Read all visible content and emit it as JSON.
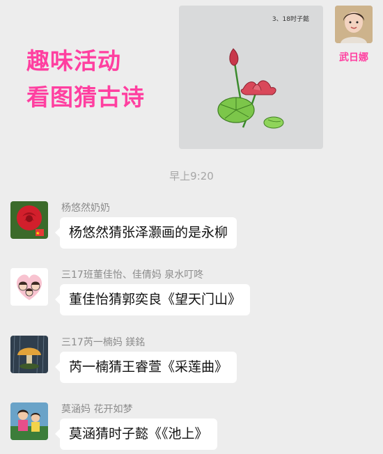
{
  "overlay": {
    "line1": "趣味活动",
    "line2": "看图猜古诗"
  },
  "image_message": {
    "photo_caption": "3、18时子懿",
    "sender_name": "武日娜"
  },
  "time_stamp": "早上9:20",
  "messages": [
    {
      "sender": "杨悠然奶奶",
      "text": "杨悠然猜张泽灏画的是永柳",
      "avatar_icon": "red-rose-avatar"
    },
    {
      "sender": "三17班董佳怡、佳倩妈 泉水叮咚",
      "text": "董佳怡猜郭奕良《望天门山》",
      "avatar_icon": "cartoon-family-avatar"
    },
    {
      "sender": "三17芮一楠妈  鎂銘",
      "text": "芮一楠猜王睿萱《采莲曲》",
      "avatar_icon": "mushroom-rain-avatar"
    },
    {
      "sender": "莫涵妈  花开如梦",
      "text": "莫涵猜时子懿《《池上》",
      "avatar_icon": "children-photo-avatar"
    }
  ],
  "colors": {
    "accent_pink": "#ff3fa0",
    "background": "#ededed",
    "bubble": "#ffffff"
  }
}
